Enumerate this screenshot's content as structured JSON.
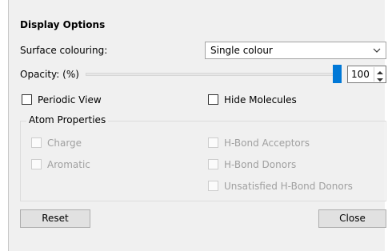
{
  "panel": {
    "title": "Display Options",
    "surface_colouring": {
      "label": "Surface colouring:",
      "selected": "Single colour"
    },
    "opacity": {
      "label": "Opacity: (%)",
      "value": "100",
      "fraction": 1.0
    },
    "periodic_view": {
      "label": "Periodic View",
      "checked": false
    },
    "hide_molecules": {
      "label": "Hide Molecules",
      "checked": false
    },
    "atom_properties": {
      "title": "Atom Properties",
      "items": [
        {
          "label": "Charge",
          "checked": false,
          "enabled": false
        },
        {
          "label": "Aromatic",
          "checked": false,
          "enabled": false
        },
        {
          "label": "H-Bond Acceptors",
          "checked": false,
          "enabled": false
        },
        {
          "label": "H-Bond Donors",
          "checked": false,
          "enabled": false
        },
        {
          "label": "Unsatisfied H-Bond Donors",
          "checked": false,
          "enabled": false
        }
      ]
    },
    "buttons": {
      "reset": "Reset",
      "close": "Close"
    }
  },
  "colors": {
    "accent": "#0078d7",
    "background": "#f0f0f0",
    "disabled_text": "#a0a0a0"
  }
}
